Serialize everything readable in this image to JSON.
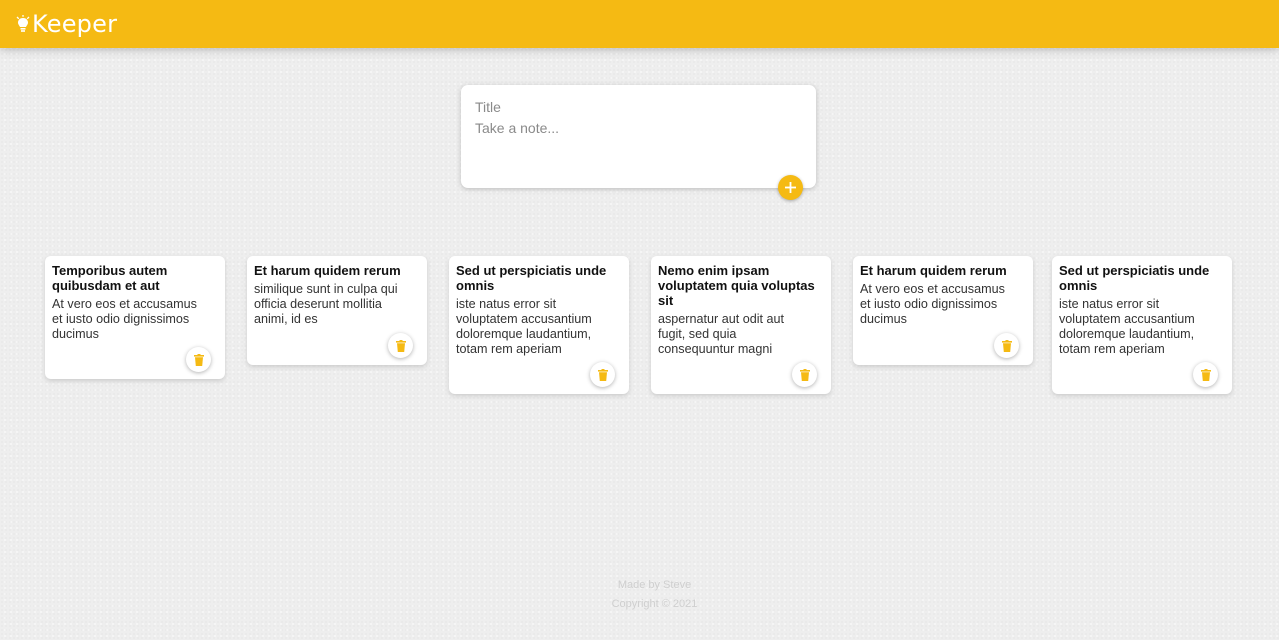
{
  "header": {
    "app_title": "Keeper",
    "logo_icon": "lightbulb-icon",
    "brand_color": "#f5ba13"
  },
  "create": {
    "title_placeholder": "Title",
    "content_placeholder": "Take a note...",
    "add_icon": "plus-icon"
  },
  "notes": [
    {
      "title": "Temporibus autem\nquibusdam et aut",
      "content": "At vero eos et accusamus\net iusto odio dignissimos\nducimus"
    },
    {
      "title": "Et harum quidem rerum",
      "content": "similique sunt in culpa qui\nofficia deserunt mollitia\nanimi, id es"
    },
    {
      "title": "Sed ut perspiciatis unde\nomnis",
      "content": "iste natus error sit\nvoluptatem accusantium\ndoloremque laudantium,\ntotam rem aperiam"
    },
    {
      "title": "Nemo enim ipsam\nvoluptatem quia voluptas\nsit",
      "content": "aspernatur aut odit aut\nfugit, sed quia\nconsequuntur magni"
    },
    {
      "title": "Et harum quidem rerum",
      "content": "At vero eos et accusamus\net iusto odio dignissimos\nducimus"
    },
    {
      "title": "Sed ut perspiciatis unde\nomnis",
      "content": "iste natus error sit\nvoluptatem accusantium\ndoloremque laudantium,\ntotam rem aperiam"
    }
  ],
  "note_delete_icon": "trash-icon",
  "footer": {
    "made_by": "Made by Steve",
    "copyright": "Copyright © 2021"
  }
}
